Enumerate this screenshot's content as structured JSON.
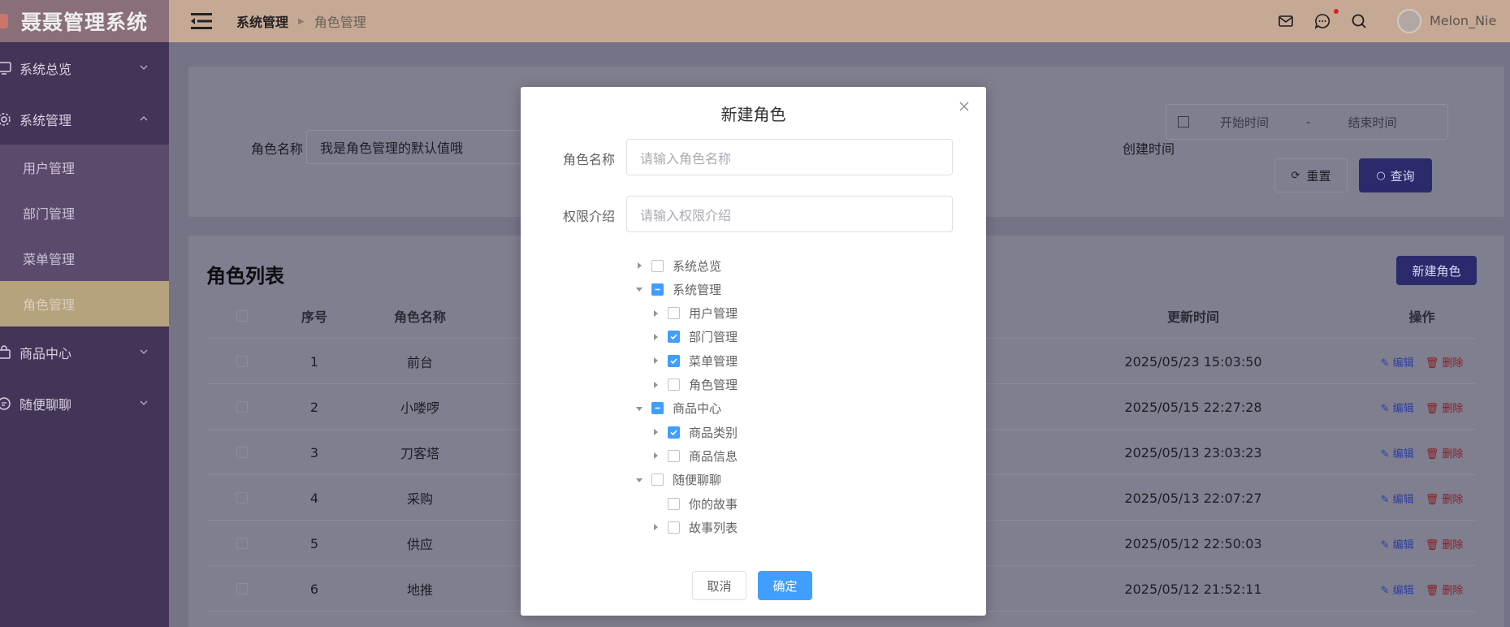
{
  "app": {
    "title": "聂聂管理系统"
  },
  "sidebar": {
    "items": [
      {
        "label": "系统总览",
        "icon": "monitor-icon"
      },
      {
        "label": "系统管理",
        "icon": "gear-icon"
      },
      {
        "label": "商品中心",
        "icon": "bag-icon"
      },
      {
        "label": "随便聊聊",
        "icon": "chat-icon"
      }
    ],
    "sub_items": [
      "用户管理",
      "部门管理",
      "菜单管理",
      "角色管理"
    ],
    "active_sub": "角色管理"
  },
  "header": {
    "breadcrumb": [
      "系统管理",
      "角色管理"
    ],
    "icons": [
      "mail-icon",
      "message-icon",
      "search-icon"
    ],
    "username": "Melon_Nie"
  },
  "search": {
    "role_name_label": "角色名称",
    "role_name_value": "我是角色管理的默认值哦",
    "create_time_label": "创建时间",
    "start_placeholder": "开始时间",
    "range_sep": "-",
    "end_placeholder": "结束时间",
    "reset_label": "重置",
    "query_label": "查询"
  },
  "list": {
    "title": "角色列表",
    "new_button": "新建角色",
    "columns": {
      "index": "序号",
      "name": "角色名称",
      "updated": "更新时间",
      "ops": "操作"
    },
    "rows": [
      {
        "index": "1",
        "name": "前台",
        "updated": "2025/05/23 15:03:50"
      },
      {
        "index": "2",
        "name": "小喽啰",
        "updated": "2025/05/15 22:27:28"
      },
      {
        "index": "3",
        "name": "刀客塔",
        "updated": "2025/05/13 23:03:23"
      },
      {
        "index": "4",
        "name": "采购",
        "updated": "2025/05/13 22:07:27"
      },
      {
        "index": "5",
        "name": "供应",
        "updated": "2025/05/12 22:50:03"
      },
      {
        "index": "6",
        "name": "地推",
        "updated": "2025/05/12 21:52:11"
      }
    ],
    "edit_label": "编辑",
    "delete_label": "删除"
  },
  "modal": {
    "title": "新建角色",
    "name_label": "角色名称",
    "name_placeholder": "请输入角色名称",
    "desc_label": "权限介绍",
    "desc_placeholder": "请输入权限介绍",
    "tree": [
      {
        "label": "系统总览",
        "level": 0,
        "arrow": "right",
        "state": "unchecked"
      },
      {
        "label": "系统管理",
        "level": 0,
        "arrow": "down",
        "state": "indeterminate"
      },
      {
        "label": "用户管理",
        "level": 1,
        "arrow": "right",
        "state": "unchecked"
      },
      {
        "label": "部门管理",
        "level": 1,
        "arrow": "right",
        "state": "checked"
      },
      {
        "label": "菜单管理",
        "level": 1,
        "arrow": "right",
        "state": "checked"
      },
      {
        "label": "角色管理",
        "level": 1,
        "arrow": "right",
        "state": "unchecked"
      },
      {
        "label": "商品中心",
        "level": 0,
        "arrow": "down",
        "state": "indeterminate"
      },
      {
        "label": "商品类别",
        "level": 1,
        "arrow": "right",
        "state": "checked"
      },
      {
        "label": "商品信息",
        "level": 1,
        "arrow": "right",
        "state": "unchecked"
      },
      {
        "label": "随便聊聊",
        "level": 0,
        "arrow": "down",
        "state": "unchecked"
      },
      {
        "label": "你的故事",
        "level": 1,
        "arrow": "none",
        "state": "unchecked"
      },
      {
        "label": "故事列表",
        "level": 1,
        "arrow": "right",
        "state": "unchecked"
      }
    ],
    "cancel_label": "取消",
    "ok_label": "确定"
  },
  "colors": {
    "accent": "#409eff",
    "sidebar": "#433558",
    "header": "#c6a995",
    "primary_dark": "#2a2b6d"
  }
}
